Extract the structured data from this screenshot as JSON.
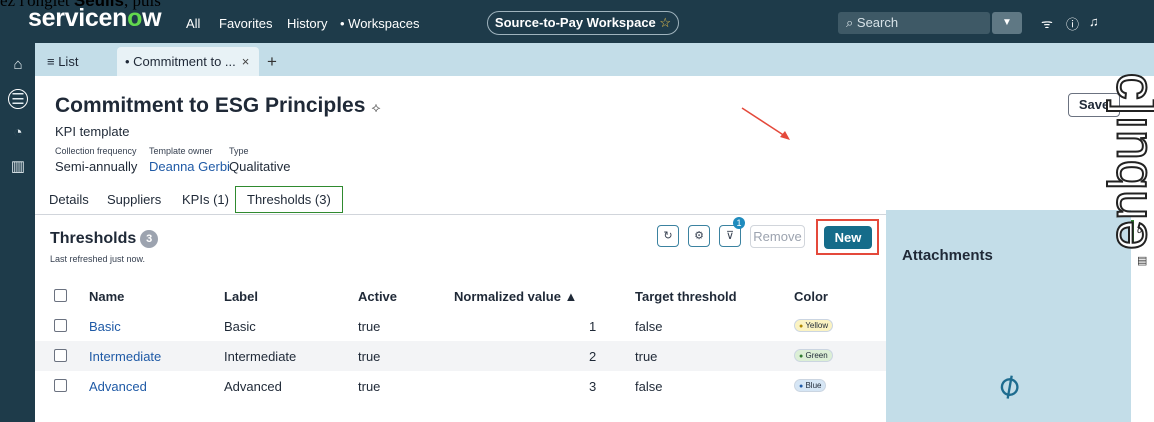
{
  "overlay": {
    "top_prefix": "ez l'onglet ",
    "top_bold": "Seuils",
    "top_suffix": ", puis",
    "vertical": "enbuı[ɔ"
  },
  "topnav": {
    "logo_pre": "servicen",
    "logo_o": "o",
    "logo_post": "w",
    "all": "All",
    "favorites": "Favorites",
    "history": "History",
    "workspaces": "• Workspaces",
    "workspace_pill": "Source-to-Pay Workspace",
    "star": "☆",
    "search_placeholder": "Search"
  },
  "tabs": {
    "list": "≡ List",
    "current": "• Commitment to ...",
    "close": "×",
    "add": "+"
  },
  "record": {
    "title": "Commitment to ESG Principles",
    "subtitle": "KPI template",
    "meta": [
      {
        "label": "Collection frequency",
        "value": "Semi-annually"
      },
      {
        "label": "Template owner",
        "value": "Deanna Gerbi"
      },
      {
        "label": "Type",
        "value": "Qualitative"
      }
    ],
    "save_label": "Save"
  },
  "subtabs": {
    "details": "Details",
    "suppliers": "Suppliers",
    "kpis": "KPIs (1)",
    "thresholds": "Thresholds (3)"
  },
  "thresholds": {
    "title": "Thresholds",
    "count": "3",
    "refreshed": "Last refreshed just now.",
    "filter_count": "1",
    "remove_label": "Remove",
    "new_label": "New",
    "columns": [
      "Name",
      "Label",
      "Active",
      "Normalized value ▲",
      "Target threshold",
      "Color"
    ],
    "rows": [
      {
        "name": "Basic",
        "label": "Basic",
        "active": "true",
        "normalized": "1",
        "target": "false",
        "color": "Yellow",
        "color_hex": "#fbf3c2",
        "dot": "#b08900"
      },
      {
        "name": "Intermediate",
        "label": "Intermediate",
        "active": "true",
        "normalized": "2",
        "target": "true",
        "color": "Green",
        "color_hex": "#dcefd6",
        "dot": "#2f7a2f"
      },
      {
        "name": "Advanced",
        "label": "Advanced",
        "active": "true",
        "normalized": "3",
        "target": "false",
        "color": "Blue",
        "color_hex": "#d6e6f5",
        "dot": "#1f5aa6"
      }
    ]
  },
  "attachments": {
    "title": "Attachments"
  }
}
